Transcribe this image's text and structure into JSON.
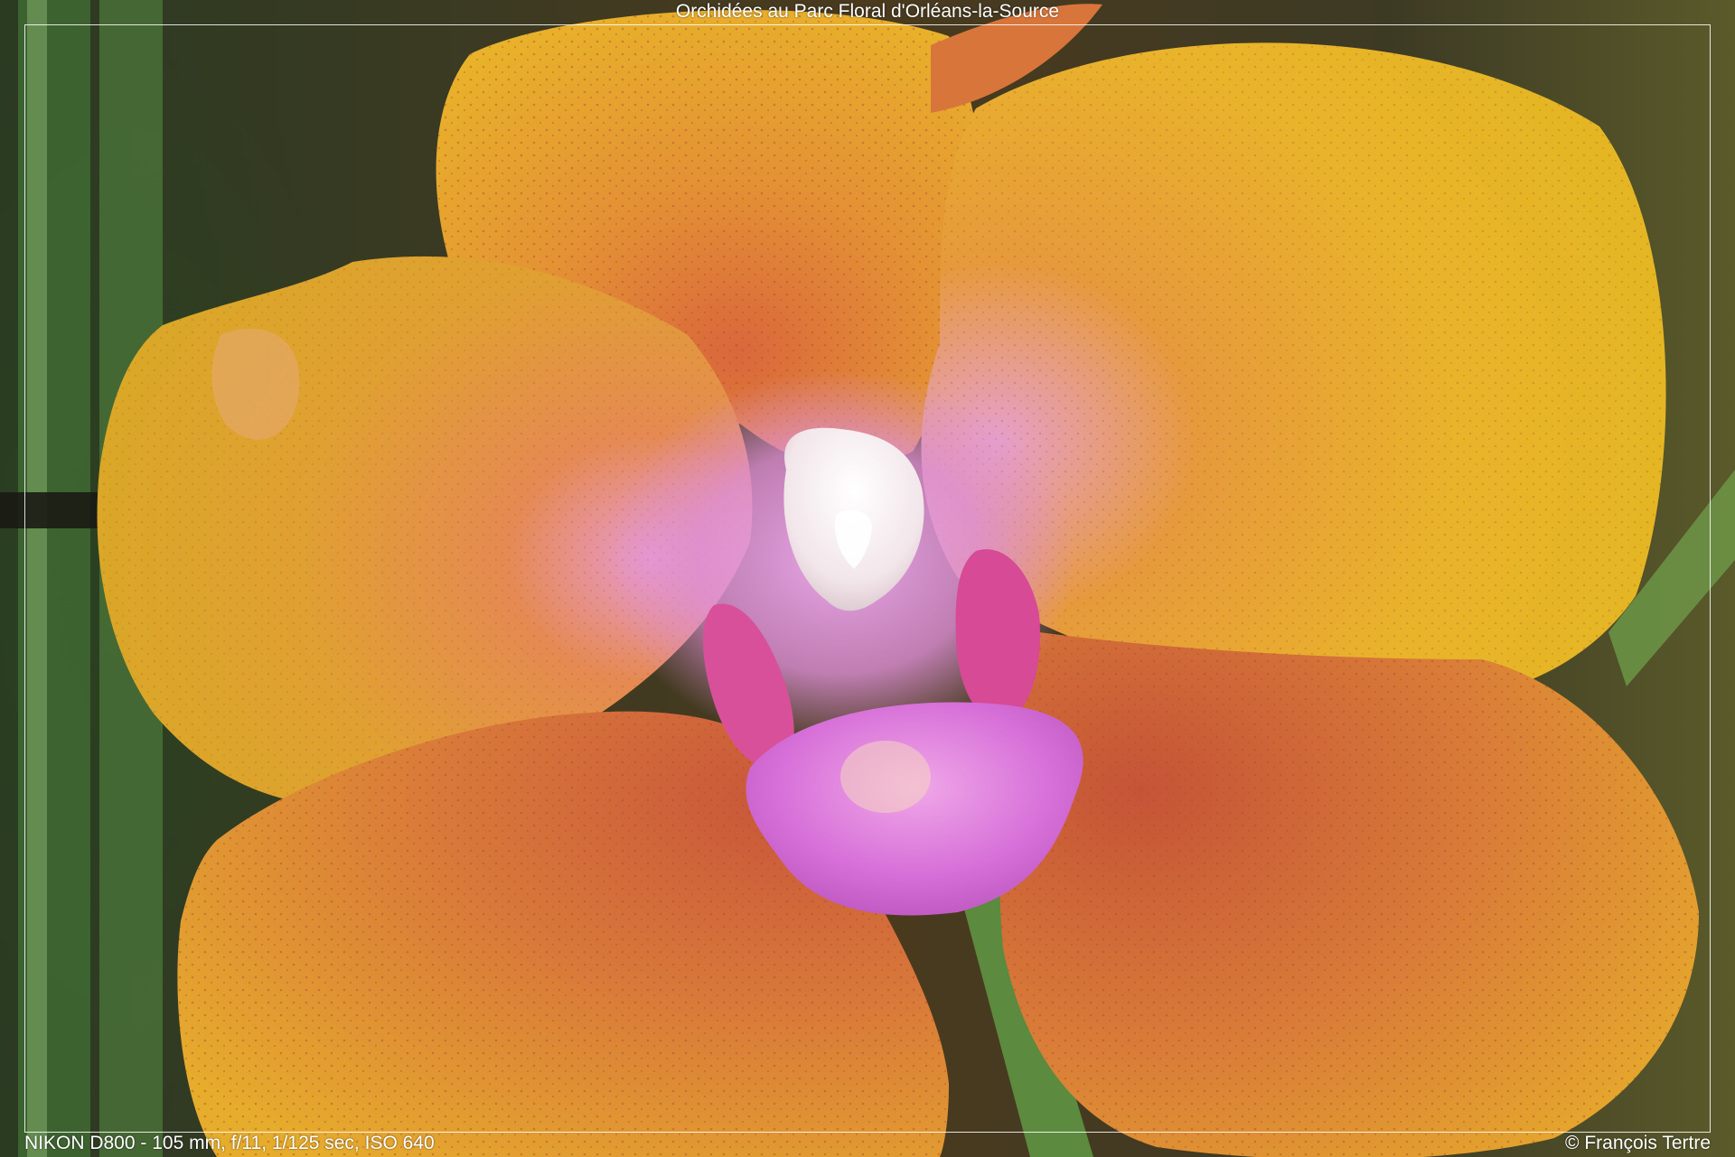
{
  "photo": {
    "title": "Orchidées au Parc Floral d'Orléans-la-Source",
    "camera_info": "NIKON D800 - 105 mm, f/11, 1/125 sec, ISO 640",
    "copyright": "© François Tertre"
  },
  "colors": {
    "frame": "#ffffff",
    "caption_text": "#ffffff",
    "petal_yellow": "#e8b22a",
    "petal_orange": "#e0803a",
    "petal_red": "#c8563a",
    "column_pink": "#d872d8",
    "column_white": "#f4ecee",
    "stem_green": "#4f7a3a"
  }
}
